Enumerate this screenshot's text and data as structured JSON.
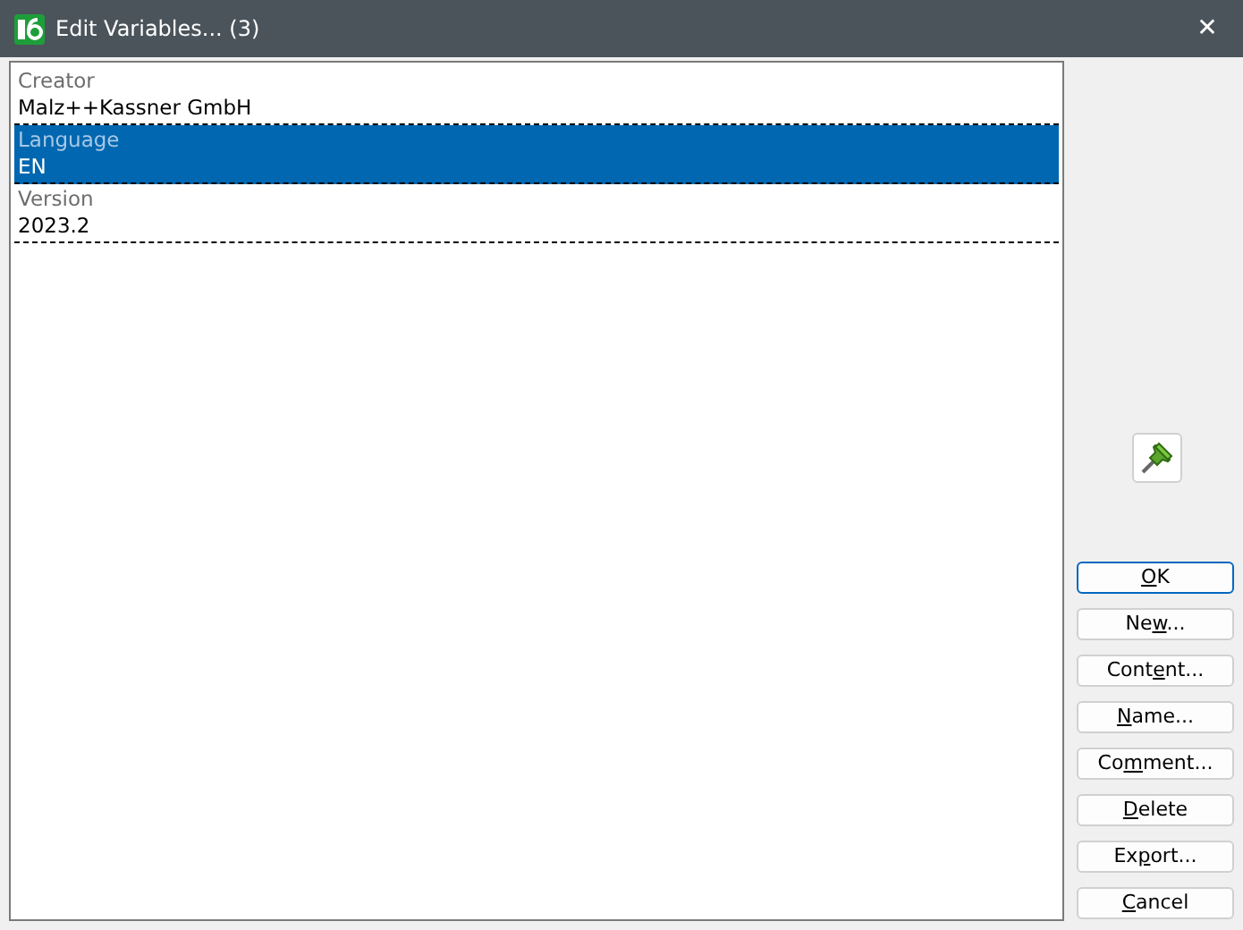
{
  "window": {
    "title": "Edit Variables... (3)",
    "close": "✕"
  },
  "variables": [
    {
      "name": "Creator",
      "value": "Malz++Kassner GmbH",
      "selected": false
    },
    {
      "name": "Language",
      "value": "EN",
      "selected": true
    },
    {
      "name": "Version",
      "value": "2023.2",
      "selected": false
    }
  ],
  "buttons": [
    {
      "label_parts": [
        {
          "text": "O",
          "underlined": true
        },
        {
          "text": "K",
          "underlined": false
        }
      ],
      "default": true
    },
    {
      "label_parts": [
        {
          "text": "Ne",
          "underlined": false
        },
        {
          "text": "w",
          "underlined": true
        },
        {
          "text": "...",
          "underlined": false
        }
      ],
      "default": false
    },
    {
      "label_parts": [
        {
          "text": "Cont",
          "underlined": false
        },
        {
          "text": "e",
          "underlined": true
        },
        {
          "text": "nt...",
          "underlined": false
        }
      ],
      "default": false
    },
    {
      "label_parts": [
        {
          "text": "N",
          "underlined": true
        },
        {
          "text": "ame...",
          "underlined": false
        }
      ],
      "default": false
    },
    {
      "label_parts": [
        {
          "text": "Co",
          "underlined": false
        },
        {
          "text": "m",
          "underlined": true
        },
        {
          "text": "ment...",
          "underlined": false
        }
      ],
      "default": false
    },
    {
      "label_parts": [
        {
          "text": "D",
          "underlined": true
        },
        {
          "text": "elete",
          "underlined": false
        }
      ],
      "default": false
    },
    {
      "label_parts": [
        {
          "text": "Ex",
          "underlined": false
        },
        {
          "text": "p",
          "underlined": true
        },
        {
          "text": "ort...",
          "underlined": false
        }
      ],
      "default": false
    },
    {
      "label_parts": [
        {
          "text": "C",
          "underlined": true
        },
        {
          "text": "ancel",
          "underlined": false
        }
      ],
      "default": false
    }
  ]
}
